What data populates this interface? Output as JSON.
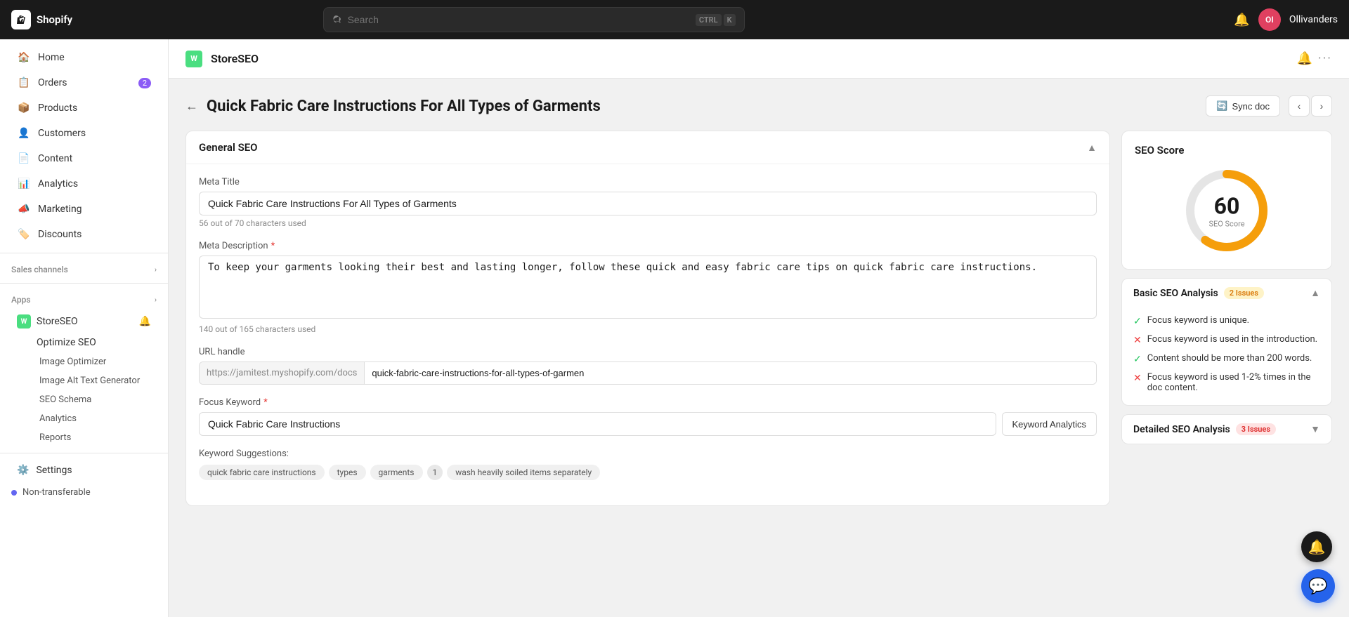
{
  "topnav": {
    "logo_text": "Shopify",
    "search_placeholder": "Search",
    "kbd1": "CTRL",
    "kbd2": "K",
    "avatar_text": "OI",
    "store_name": "Ollivanders"
  },
  "sidebar": {
    "items": [
      {
        "label": "Home",
        "icon": "home"
      },
      {
        "label": "Orders",
        "icon": "orders",
        "badge": "2"
      },
      {
        "label": "Products",
        "icon": "products"
      },
      {
        "label": "Customers",
        "icon": "customers"
      },
      {
        "label": "Content",
        "icon": "content"
      },
      {
        "label": "Analytics",
        "icon": "analytics"
      },
      {
        "label": "Marketing",
        "icon": "marketing"
      },
      {
        "label": "Discounts",
        "icon": "discounts"
      }
    ],
    "sales_channels_label": "Sales channels",
    "apps_label": "Apps",
    "storeseo_label": "StoreSEO",
    "optimize_seo_label": "Optimize SEO",
    "image_optimizer_label": "Image Optimizer",
    "image_alt_label": "Image Alt Text Generator",
    "seo_schema_label": "SEO Schema",
    "analytics_label": "Analytics",
    "reports_label": "Reports",
    "settings_label": "Settings",
    "non_transferable_label": "Non-transferable"
  },
  "app_header": {
    "title": "StoreSEO"
  },
  "page": {
    "title": "Quick Fabric Care Instructions For All Types of Garments",
    "sync_btn": "Sync doc"
  },
  "general_seo": {
    "section_title": "General SEO",
    "meta_title_label": "Meta Title",
    "meta_title_value": "Quick Fabric Care Instructions For All Types of Garments",
    "meta_title_hint": "56 out of 70 characters used",
    "meta_desc_label": "Meta Description",
    "meta_desc_value": "To keep your garments looking their best and lasting longer, follow these quick and easy fabric care tips on quick fabric care instructions.",
    "meta_desc_hint": "140 out of 165 characters used",
    "url_handle_label": "URL handle",
    "url_prefix": "https://jamitest.myshopify.com/docs",
    "url_handle_value": "quick-fabric-care-instructions-for-all-types-of-garmen",
    "focus_keyword_label": "Focus Keyword",
    "focus_keyword_value": "Quick Fabric Care Instructions",
    "keyword_analytics_btn": "Keyword Analytics",
    "keyword_suggestions_label": "Keyword Suggestions:",
    "tags": [
      "quick fabric care instructions",
      "types",
      "garments",
      "1",
      "wash heavily soiled items separately"
    ]
  },
  "seo_score": {
    "title": "SEO Score",
    "score": "60",
    "score_label": "SEO Score",
    "progress_pct": 60
  },
  "basic_seo": {
    "title": "Basic SEO Analysis",
    "badge": "2 Issues",
    "items": [
      {
        "status": "pass",
        "text": "Focus keyword is unique."
      },
      {
        "status": "fail",
        "text": "Focus keyword is used in the introduction."
      },
      {
        "status": "pass",
        "text": "Content should be more than 200 words."
      },
      {
        "status": "fail",
        "text": "Focus keyword is used 1-2% times in the doc content."
      }
    ]
  },
  "detailed_seo": {
    "title": "Detailed SEO Analysis",
    "badge": "3 Issues"
  }
}
